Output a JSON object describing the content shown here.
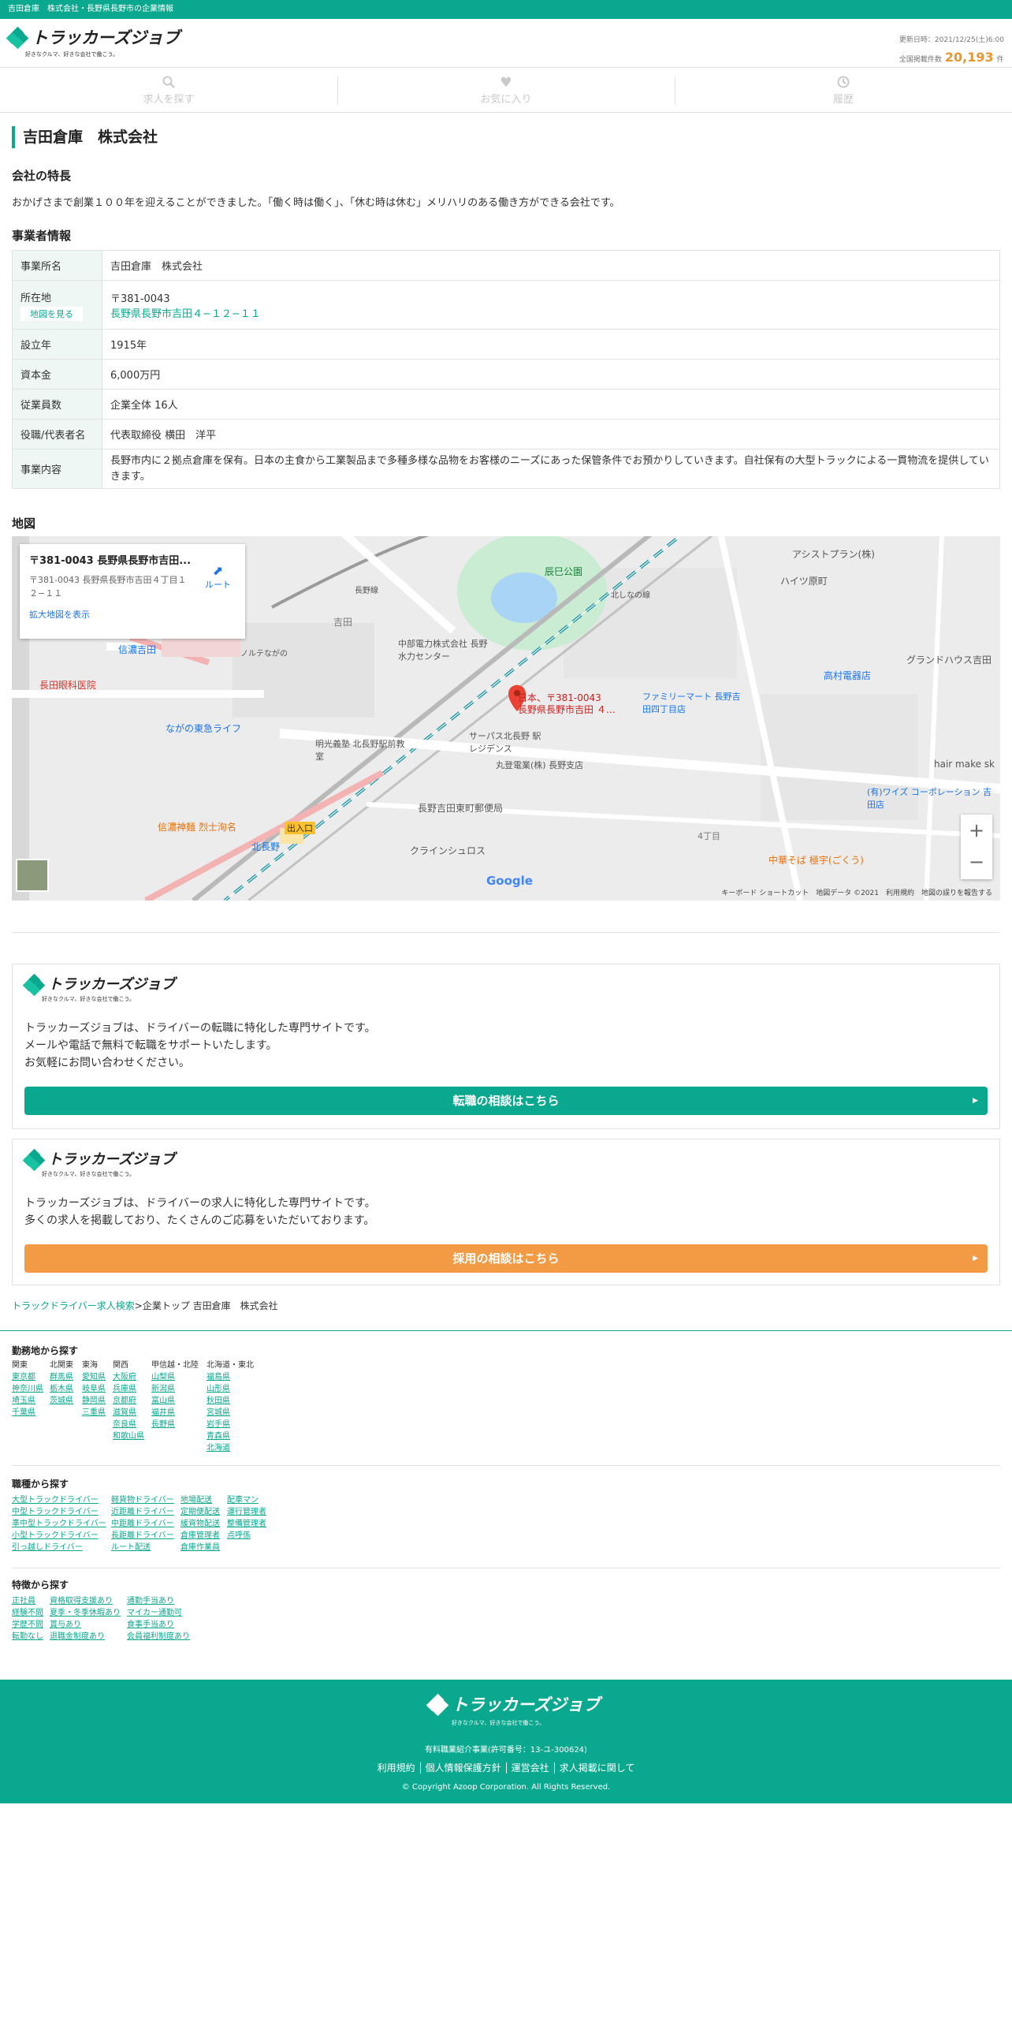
{
  "topbar": {
    "text": "吉田倉庫　株式会社・長野県長野市の企業情報"
  },
  "header": {
    "logo_text": "トラッカーズジョブ",
    "logo_tagline": "好きなクルマ、好きな会社で働こう。",
    "updated_label": "更新日時：2021/12/25(土)6:00",
    "count_label": "全国掲載件数",
    "count": "20,193",
    "count_unit": "件"
  },
  "nav": [
    {
      "label": "求人を探す",
      "icon": "search-icon"
    },
    {
      "label": "お気に入り",
      "icon": "heart-icon"
    },
    {
      "label": "履歴",
      "icon": "history-icon"
    }
  ],
  "company": {
    "name": "吉田倉庫　株式会社",
    "feature_heading": "会社の特長",
    "feature_text": "おかげさまで創業１００年を迎えることができました。「働く時は働く」、「休む時は休む」メリハリのある働き方ができる会社です。",
    "info_heading": "事業者情報",
    "rows": [
      {
        "label": "事業所名",
        "value": "吉田倉庫　株式会社"
      },
      {
        "label": "所在地",
        "map_button": "地図を見る",
        "postal": "〒381-0043",
        "address": "長野県長野市吉田４−１２−１１"
      },
      {
        "label": "設立年",
        "value": "1915年"
      },
      {
        "label": "資本金",
        "value": "6,000万円"
      },
      {
        "label": "従業員数",
        "value": "企業全体 16人"
      },
      {
        "label": "役職/代表者名",
        "value": "代表取締役 横田　洋平"
      },
      {
        "label": "事業内容",
        "value": "長野市内に２拠点倉庫を保有。日本の主食から工業製品まで多種多様な品物をお客様のニーズにあった保管条件でお預かりしていきます。自社保有の大型トラックによる一貫物流を提供していきます。"
      }
    ]
  },
  "map": {
    "heading": "地図",
    "card_title": "〒381-0043 長野県長野市吉田...",
    "card_address": "〒381-0043 長野県長野市吉田４丁目１２−１１",
    "card_route": "ルート",
    "card_enlarge": "拡大地図を表示",
    "pin_label_1": "日本、〒381-0043",
    "pin_label_2": "長野県長野市吉田 ４…",
    "labels": [
      "辰巳公園",
      "アシストプラン(株)",
      "ハイツ原町",
      "長野線",
      "吉田",
      "北しなの線",
      "信濃吉田",
      "長田眼科医院",
      "ノルテながの",
      "中部電力株式会社 長野水力センター",
      "ファミリーマート 長野吉田四丁目店",
      "高村電器店",
      "グランドハウス吉田",
      "ながの東急ライフ",
      "明光義塾 北長野駅前教室",
      "サーパス北長野 駅レジデンス",
      "丸登電業(株) 長野支店",
      "長野吉田東町郵便局",
      "hair make sk",
      "(有)ワイズ コーポレーション 吉田店",
      "信濃神麺 烈士洵名",
      "北長野",
      "クラインシュロス",
      "中華そば 極宇(ごくう)",
      "出入口",
      "4丁目"
    ],
    "footer": "キーボード ショートカット　地図データ ©2021　利用規約　地図の誤りを報告する",
    "google": "Google"
  },
  "cta_driver": {
    "lines": [
      "トラッカーズジョブは、ドライバーの転職に特化した専門サイトです。",
      "メールや電話で無料で転職をサポートいたします。",
      "お気軽にお問い合わせください。"
    ],
    "button": "転職の相談はこちら",
    "color": "#0aa88f"
  },
  "cta_company": {
    "lines": [
      "トラッカーズジョブは、ドライバーの求人に特化した専門サイトです。",
      "多くの求人を掲載しており、たくさんのご応募をいただいております。"
    ],
    "button": "採用の相談はこちら",
    "color": "#f39a45"
  },
  "breadcrumb": {
    "link": "トラックドライバー求人検索",
    "rest": ">企業トップ 吉田倉庫　株式会社"
  },
  "footer_links": {
    "area_heading": "勤務地から探す",
    "areas": [
      {
        "name": "関東",
        "items": [
          "東京都",
          "神奈川県",
          "埼玉県",
          "千葉県"
        ]
      },
      {
        "name": "北関東",
        "items": [
          "群馬県",
          "栃木県",
          "茨城県"
        ]
      },
      {
        "name": "東海",
        "items": [
          "愛知県",
          "岐阜県",
          "静岡県",
          "三重県"
        ]
      },
      {
        "name": "関西",
        "items": [
          "大阪府",
          "兵庫県",
          "京都府",
          "滋賀県",
          "奈良県",
          "和歌山県"
        ]
      },
      {
        "name": "甲信越・北陸",
        "items": [
          "山梨県",
          "新潟県",
          "富山県",
          "福井県",
          "長野県"
        ]
      },
      {
        "name": "北海道・東北",
        "items": [
          "福島県",
          "山形県",
          "秋田県",
          "宮城県",
          "岩手県",
          "青森県",
          "北海道"
        ]
      }
    ],
    "job_heading": "職種から探す",
    "jobs": [
      [
        "大型トラックドライバー",
        "中型トラックドライバー",
        "準中型トラックドライバー",
        "小型トラックドライバー",
        "引っ越しドライバー"
      ],
      [
        "軽貨物ドライバー",
        "近距離ドライバー",
        "中距離ドライバー",
        "長距離ドライバー",
        "ルート配送"
      ],
      [
        "地場配送",
        "定期便配送",
        "緩資物配送",
        "倉庫管理者",
        "倉庫作業員"
      ],
      [
        "配車マン",
        "運行管理者",
        "整備管理者",
        "点呼係"
      ]
    ],
    "feature_heading": "特徴から探す",
    "features": [
      [
        "正社員",
        "経験不問",
        "学歴不問",
        "転勤なし"
      ],
      [
        "資格取得支援あり",
        "夏季・冬季休暇あり",
        "賞与あり",
        "退職金制度あり"
      ],
      [
        "通勤手当あり",
        "マイカー通勤可",
        "食事手当あり",
        "会員福利制度あり"
      ]
    ]
  },
  "footer": {
    "logo_text": "トラッカーズジョブ",
    "logo_tagline": "好きなクルマ、好きな会社で働こう。",
    "permit": "有料職業紹介事業(許可番号：13-ユ-300624)",
    "links": [
      "利用規約",
      "個人情報保護方針",
      "運営会社",
      "求人掲載に関して"
    ],
    "copyright": "© Copyright Azoop Corporation. All Rights Reserved."
  }
}
